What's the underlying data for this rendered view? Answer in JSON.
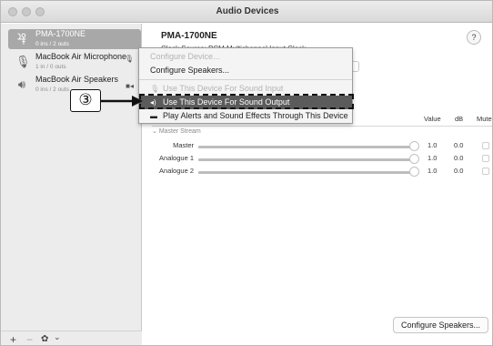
{
  "window": {
    "title": "Audio Devices"
  },
  "sidebar": {
    "devices": [
      {
        "name": "PMA-1700NE",
        "sub": "0 ins / 2 outs",
        "icon": "usb-icon"
      },
      {
        "name": "MacBook Air Microphone",
        "sub": "1 in / 0 outs",
        "icon": "microphone-icon"
      },
      {
        "name": "MacBook Air Speakers",
        "sub": "0 ins / 2 outs",
        "icon": "speaker-icon"
      }
    ],
    "add_label": "+",
    "remove_label": "−",
    "gear_label": "✿",
    "menu_chevron": "⌄"
  },
  "main": {
    "device_title": "PMA-1700NE",
    "clock_label": "Clock Source:  PCM Multichannel  Input Clock",
    "help": "?",
    "columns": {
      "value": "Value",
      "db": "dB",
      "mute": "Mute"
    },
    "stream_label": "Master Stream",
    "rows": [
      {
        "label": "Master",
        "value": "1.0",
        "db": "0.0"
      },
      {
        "label": "Analogue 1",
        "value": "1.0",
        "db": "0.0"
      },
      {
        "label": "Analogue 2",
        "value": "1.0",
        "db": "0.0"
      }
    ],
    "configure_button": "Configure Speakers..."
  },
  "context_menu": {
    "items": [
      {
        "label": "Configure Device...",
        "state": "disabled"
      },
      {
        "label": "Configure Speakers...",
        "state": "enabled"
      },
      {
        "label": "Use This Device For Sound Input",
        "state": "disabled",
        "icon": "microphone-icon"
      },
      {
        "label": "Use This Device For Sound Output",
        "state": "highlighted",
        "icon": "speaker-icon"
      },
      {
        "label": "Play Alerts and Sound Effects Through This Device",
        "state": "enabled",
        "icon": "speech-bubble-icon"
      }
    ]
  },
  "annotation": {
    "callout_label": "③"
  },
  "colors": {
    "selected_row": "#a8a8a8",
    "menu_highlight": "#5b5b5b"
  }
}
